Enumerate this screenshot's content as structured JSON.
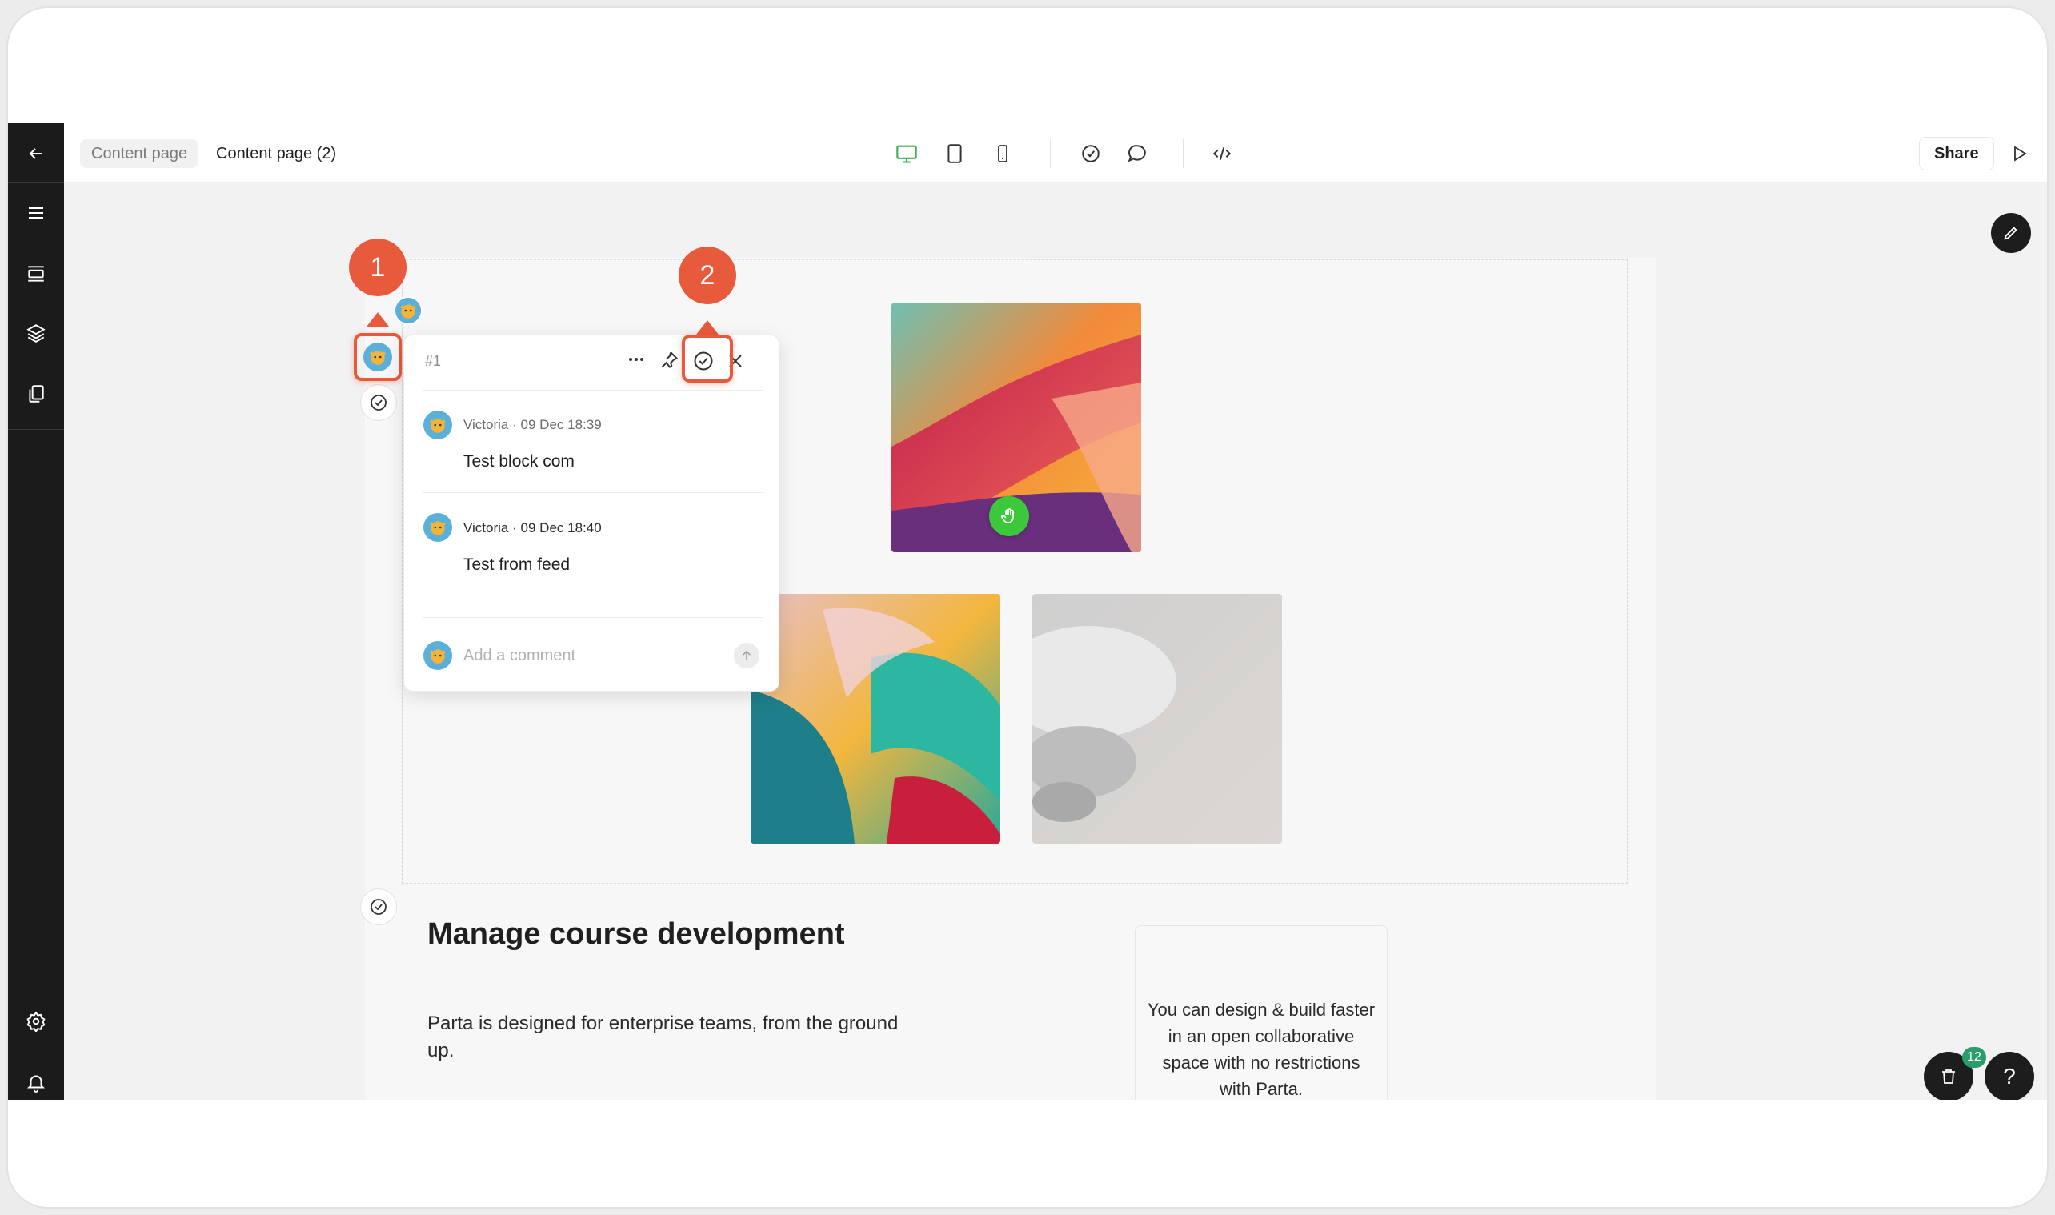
{
  "breadcrumb": {
    "parent": "Content page",
    "current": "Content page (2)"
  },
  "toolbar": {
    "share_label": "Share"
  },
  "comment_thread": {
    "id": "#1",
    "comments": [
      {
        "author": "Victoria",
        "separator": "·",
        "time": "09 Dec 18:39",
        "text": "Test block com"
      },
      {
        "author": "Victoria",
        "separator": "·",
        "time": "09 Dec 18:40",
        "text": "Test from feed"
      }
    ],
    "input_placeholder": "Add a comment"
  },
  "callouts": {
    "first": "1",
    "second": "2"
  },
  "content": {
    "heading": "Manage course development",
    "paragraph": "Parta is designed for enterprise teams, from the ground up.",
    "card_text": "You can design & build faster in an open collaborative space with no restrictions with Parta."
  },
  "notifications": {
    "count": "12"
  },
  "help": {
    "label": "?"
  },
  "colors": {
    "accent": "#e85a3c",
    "device_active": "#3fae4f",
    "green_dot": "#3bc93b",
    "rail": "#1b1b1b",
    "badge": "#2a9d6a"
  },
  "icons": [
    "back-arrow-icon",
    "menu-icon",
    "sections-icon",
    "layers-icon",
    "pages-icon",
    "settings-icon",
    "bell-icon",
    "desktop-icon",
    "tablet-icon",
    "mobile-icon",
    "check-circle-icon",
    "comment-icon",
    "code-icon",
    "play-icon",
    "pencil-icon",
    "more-icon",
    "pin-icon",
    "close-icon",
    "send-icon",
    "trash-icon",
    "drag-icon"
  ]
}
